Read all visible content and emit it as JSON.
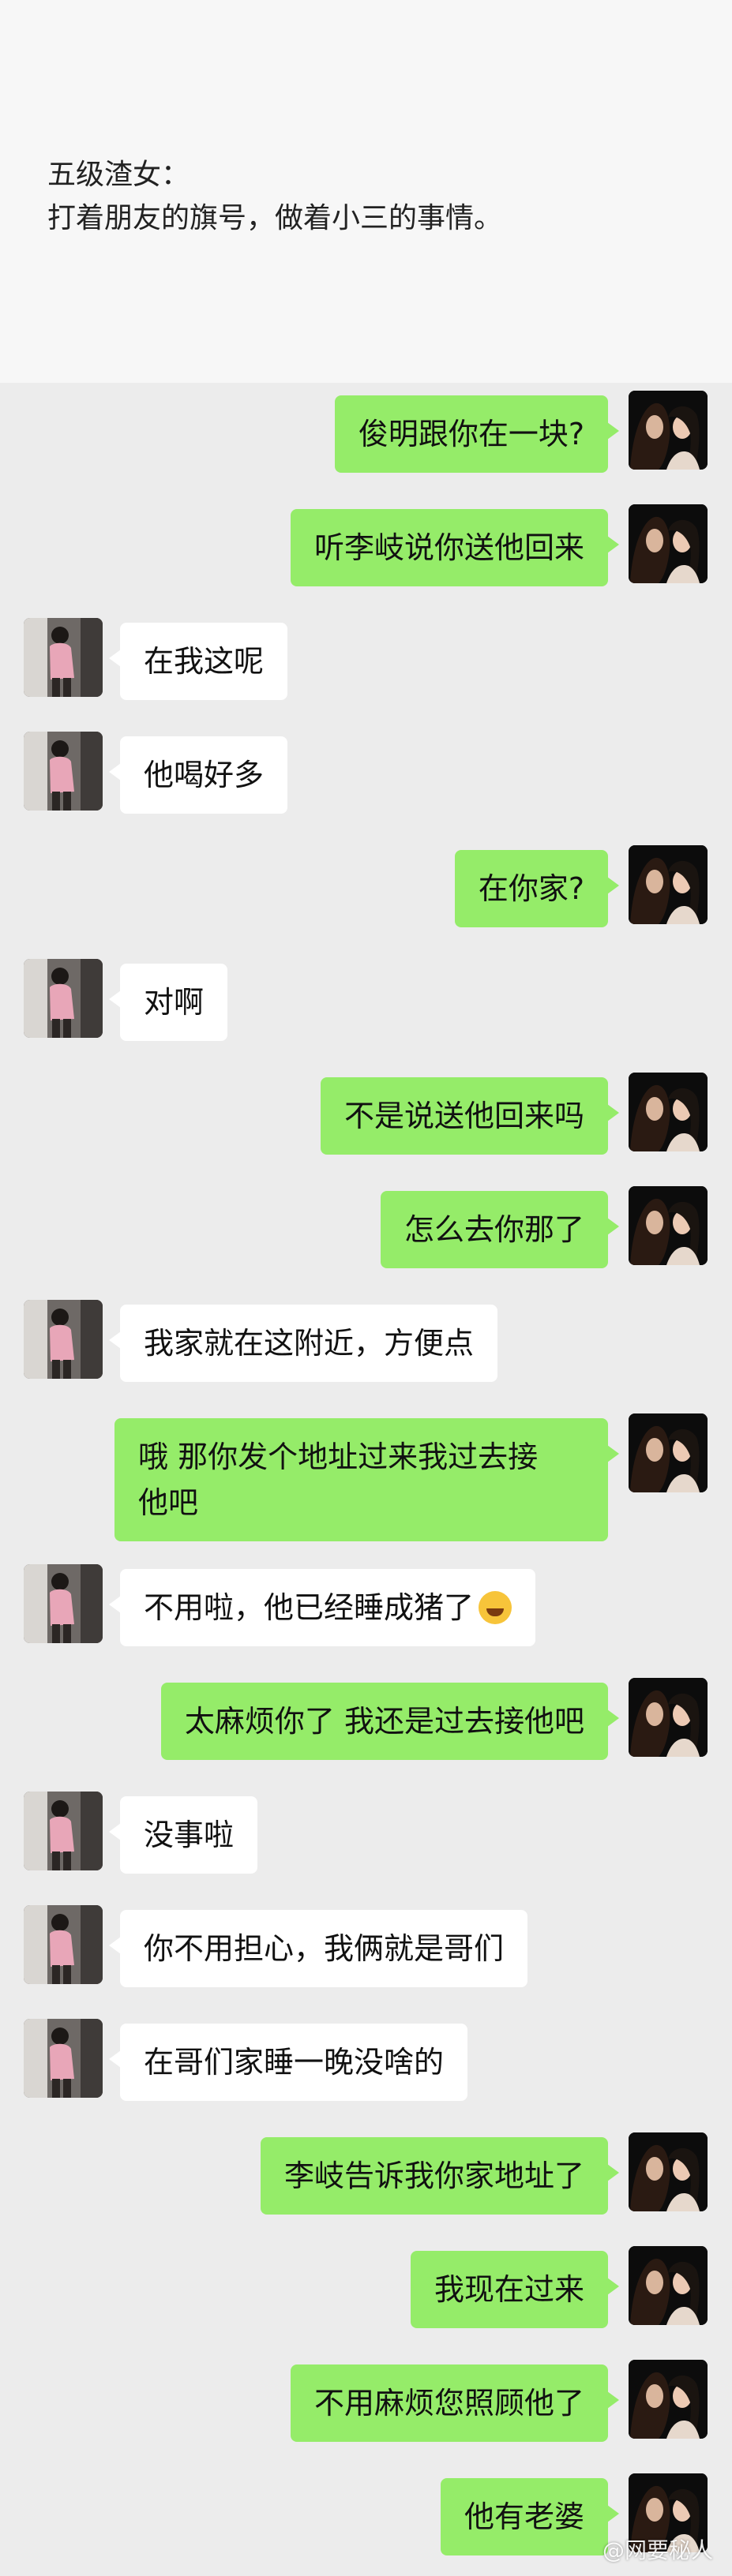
{
  "caption": {
    "title": "五级渣女：",
    "subtitle": "打着朋友的旗号，做着小三的事情。"
  },
  "messages": [
    {
      "from": "me",
      "text": "俊明跟你在一块?"
    },
    {
      "from": "me",
      "text": "听李岐说你送他回来"
    },
    {
      "from": "other",
      "text": "在我这呢"
    },
    {
      "from": "other",
      "text": "他喝好多"
    },
    {
      "from": "me",
      "text": "在你家?"
    },
    {
      "from": "other",
      "text": "对啊"
    },
    {
      "from": "me",
      "text": "不是说送他回来吗"
    },
    {
      "from": "me",
      "text": "怎么去你那了"
    },
    {
      "from": "other",
      "text": "我家就在这附近，方便点"
    },
    {
      "from": "me",
      "text": "哦 那你发个地址过来我过去接\n他吧"
    },
    {
      "from": "other",
      "text": "不用啦，他已经睡成猪了",
      "emoji": "face-with-tears-of-joy-icon"
    },
    {
      "from": "me",
      "text": "太麻烦你了 我还是过去接他吧"
    },
    {
      "from": "other",
      "text": "没事啦"
    },
    {
      "from": "other",
      "text": "你不用担心，我俩就是哥们"
    },
    {
      "from": "other",
      "text": "在哥们家睡一晚没啥的"
    },
    {
      "from": "me",
      "text": "李岐告诉我你家地址了"
    },
    {
      "from": "me",
      "text": "我现在过来"
    },
    {
      "from": "me",
      "text": "不用麻烦您照顾他了"
    },
    {
      "from": "me",
      "text": "他有老婆"
    }
  ],
  "watermark": "@网要秘人",
  "colors": {
    "my_bubble": "#95ec69",
    "their_bubble": "#ffffff",
    "chat_background": "#ececec"
  }
}
